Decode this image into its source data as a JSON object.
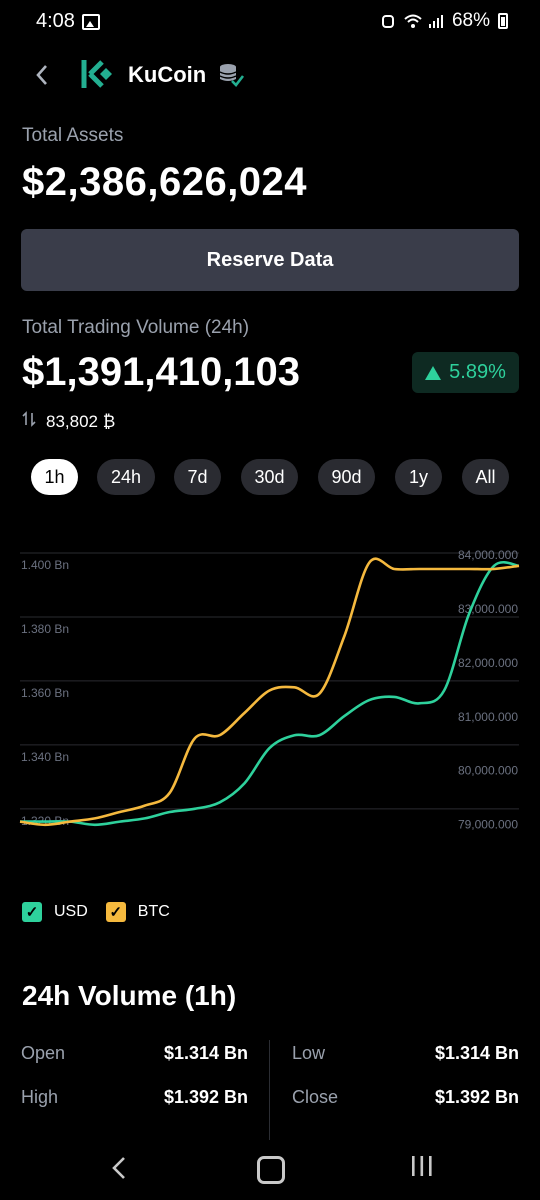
{
  "status_bar": {
    "time": "4:08",
    "battery": "68%"
  },
  "header": {
    "brand": "KuCoin"
  },
  "total_assets": {
    "label": "Total Assets",
    "value": "$2,386,626,024"
  },
  "reserve_button": "Reserve Data",
  "trading_volume": {
    "label": "Total Trading Volume (24h)",
    "value": "$1,391,410,103",
    "change": "5.89%",
    "btc_amount": "83,802 ₿"
  },
  "tabs": [
    "1h",
    "24h",
    "7d",
    "30d",
    "90d",
    "1y",
    "All"
  ],
  "active_tab": "1h",
  "colors": {
    "usd": "#2ed19c",
    "btc": "#f5b93e",
    "positive": "#2ed19c",
    "button_bg": "#3a3d4a"
  },
  "chart_data": {
    "type": "line",
    "left_axis_ticks": [
      "1.400 Bn",
      "1.380 Bn",
      "1.360 Bn",
      "1.340 Bn",
      "1.320 Bn"
    ],
    "right_axis_ticks": [
      "84,000.000",
      "83,000.000",
      "82,000.000",
      "81,000.000",
      "80,000.000",
      "79,000.000"
    ],
    "left_ylim": [
      1.314,
      1.4
    ],
    "right_ylim": [
      78900,
      84000
    ],
    "x_count": 21,
    "grid": true,
    "legend_placement": "bottom-left",
    "series": [
      {
        "name": "USD",
        "axis": "left",
        "values": [
          1.316,
          1.316,
          1.316,
          1.315,
          1.316,
          1.317,
          1.319,
          1.32,
          1.322,
          1.328,
          1.339,
          1.343,
          1.343,
          1.349,
          1.354,
          1.355,
          1.353,
          1.357,
          1.381,
          1.396,
          1.396
        ]
      },
      {
        "name": "BTC",
        "axis": "left",
        "values": [
          1.316,
          1.315,
          1.316,
          1.317,
          1.319,
          1.321,
          1.325,
          1.342,
          1.343,
          1.35,
          1.357,
          1.358,
          1.356,
          1.374,
          1.397,
          1.395,
          1.395,
          1.395,
          1.395,
          1.395,
          1.396
        ]
      }
    ]
  },
  "volume_section": {
    "title": "24h Volume (1h)",
    "rows": [
      {
        "label": "Open",
        "value": "$1.314 Bn"
      },
      {
        "label": "Low",
        "value": "$1.314 Bn"
      },
      {
        "label": "High",
        "value": "$1.392 Bn"
      },
      {
        "label": "Close",
        "value": "$1.392 Bn"
      }
    ]
  },
  "legend": [
    {
      "name": "USD",
      "checked": true
    },
    {
      "name": "BTC",
      "checked": true
    }
  ]
}
